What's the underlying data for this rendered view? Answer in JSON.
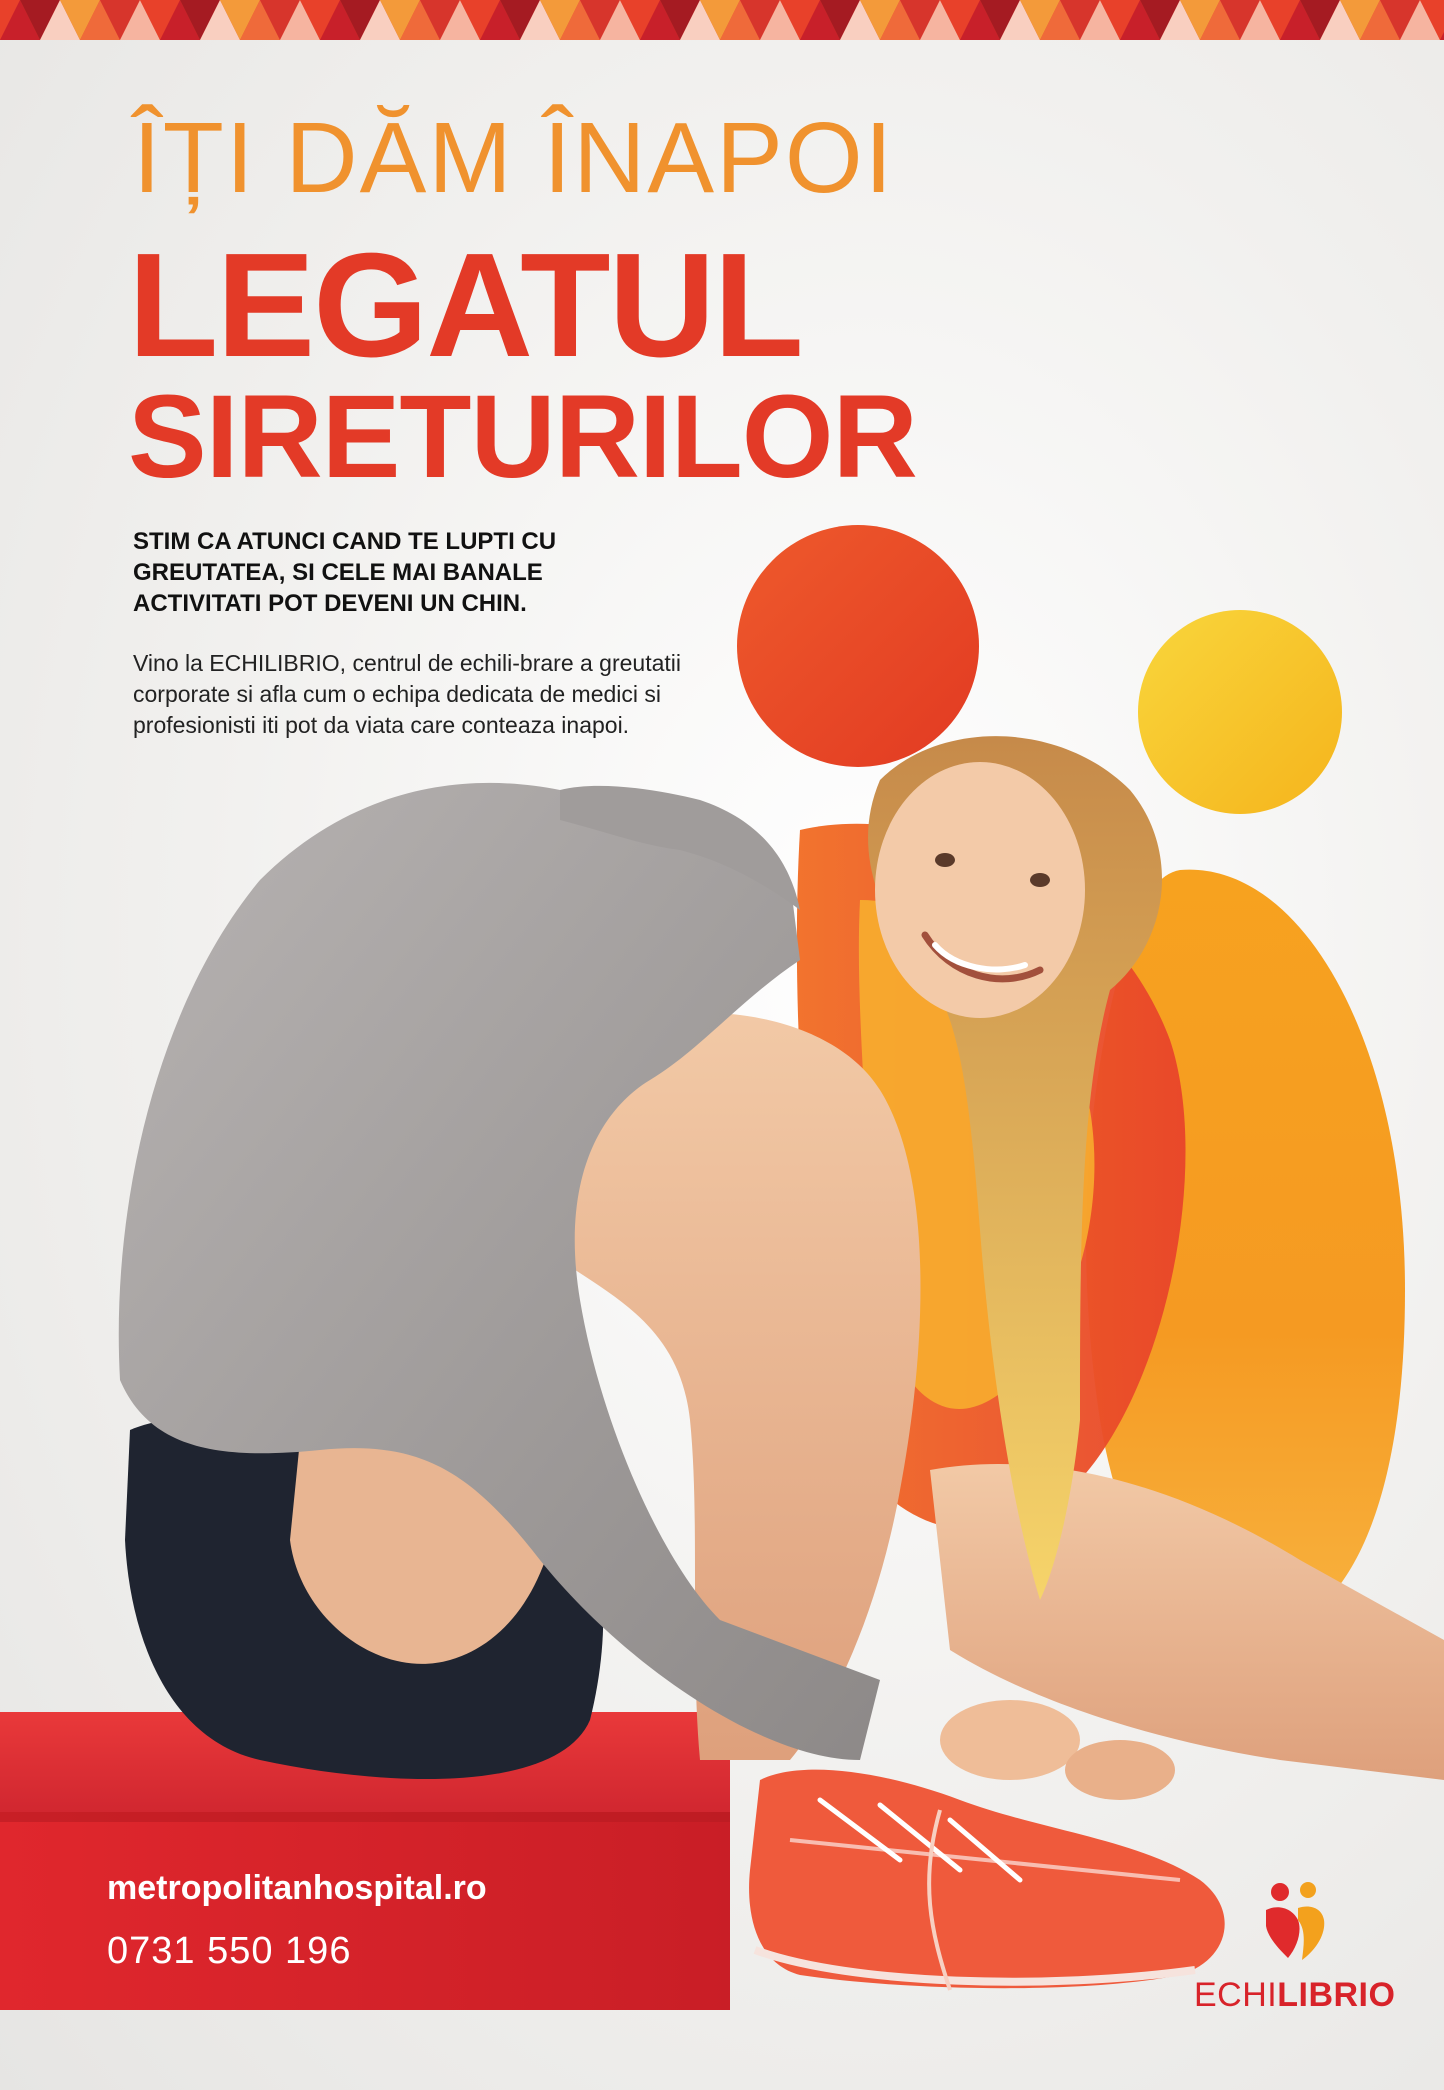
{
  "headline": {
    "line1": "ÎȚI DĂM ÎNAPOI",
    "line2": "LEGATUL",
    "line3": "SIRETURILOR"
  },
  "intro": {
    "bold": "STIM CA ATUNCI CAND TE LUPTI CU GREUTATEA,  SI CELE MAI BANALE ACTIVITATI POT DEVENI UN CHIN.",
    "body": "Vino la ECHILIBRIO, centrul de echili-brare a greutatii corporate si afla cum o echipa dedicata de medici si profesionisti iti pot da viata care conteaza inapoi."
  },
  "contact": {
    "website": "metropolitanhospital.ro",
    "phone": "0731 550 196"
  },
  "logo": {
    "part1": "ECHI",
    "part2": "LIBRIO"
  },
  "colors": {
    "accent_red": "#e33a27",
    "accent_orange": "#f0922e",
    "accent_yellow": "#f7c52b",
    "brand_red": "#d8232a"
  },
  "icons": [
    "top-pattern-strip",
    "red-circle",
    "yellow-circle",
    "orange-shape",
    "person-photo",
    "red-step-block",
    "echilibrio-logo-icon"
  ]
}
